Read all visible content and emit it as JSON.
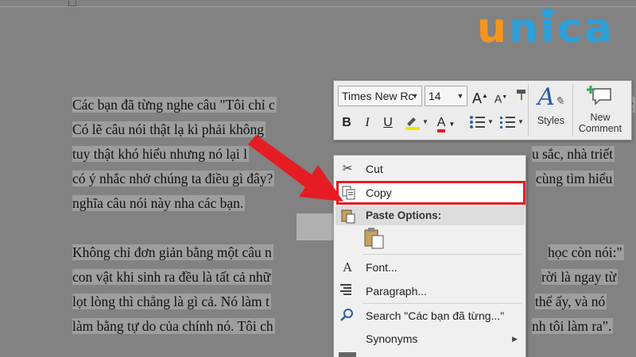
{
  "document": {
    "lines": [
      "Các bạn đã từng nghe câu \"Tôi chỉ c",
      "Có lẽ câu nói thật lạ kì phải không ",
      "tuy thật khó hiểu nhưng nó lại l",
      "có ý nhắc nhở chúng ta điều gì đây?",
      "nghĩa câu nói này nha các bạn.",
      "Không chỉ đơn giản bằng một câu n",
      "con vật khi sinh ra đều là tất cả nhữ",
      "lọt lòng thì chẳng là gì cả. Nó làm t",
      "làm bằng tự do của chính nó. Tôi ch"
    ],
    "right_fragments": [
      "c",
      "",
      "u sắc, nhà triết",
      "cùng tìm hiểu",
      "",
      "học còn nói:\"",
      "rời là ngay từ",
      "thể ấy, và nó",
      "nh tôi làm ra\"."
    ]
  },
  "logo": {
    "text_u": "u",
    "text_rest": "nica",
    "colors": {
      "u": "#f7941d",
      "rest": "#2e9fd8"
    }
  },
  "mini_toolbar": {
    "font_name": "Times New Rc",
    "font_size": "14",
    "grow_font": "A",
    "shrink_font": "A",
    "bold": "B",
    "italic": "I",
    "underline": "U",
    "font_color": "A",
    "styles_label": "Styles",
    "new_comment_line1": "New",
    "new_comment_line2": "Comment"
  },
  "context_menu": {
    "items": [
      {
        "label": "Cut",
        "icon": "scissors-icon"
      },
      {
        "label": "Copy",
        "icon": "copy-icon"
      },
      {
        "label": "Paste Options:",
        "icon": "paste-icon"
      },
      {
        "label": "Font...",
        "icon": "font-icon"
      },
      {
        "label": "Paragraph...",
        "icon": "paragraph-icon"
      },
      {
        "label": "Search \"Các bạn đã từng...\"",
        "icon": "search-icon"
      },
      {
        "label": "Synonyms",
        "icon": ""
      }
    ],
    "highlight_color": "#e51c23"
  }
}
